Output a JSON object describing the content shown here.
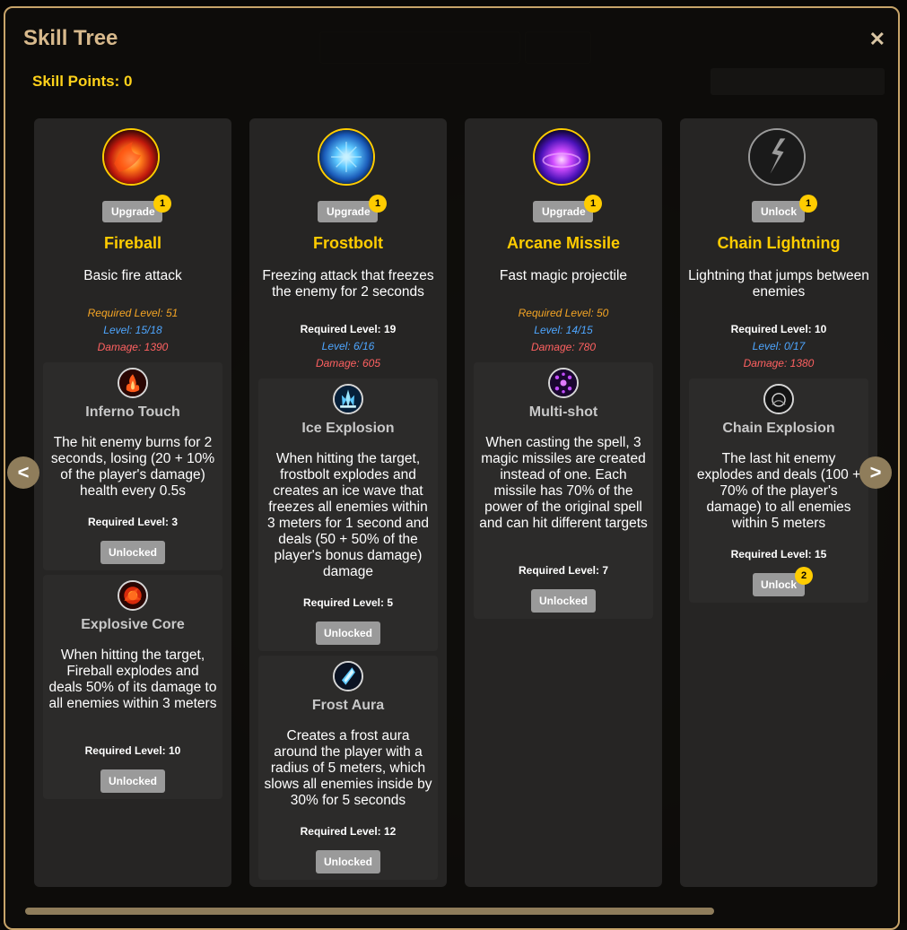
{
  "modal": {
    "title": "Skill Tree",
    "close_glyph": "✕"
  },
  "skill_points": {
    "label": "Skill Points:",
    "value": "0"
  },
  "nav": {
    "prev": "<",
    "next": ">"
  },
  "colors": {
    "accent_gold": "#ffcc00",
    "frame": "#c7a46a",
    "level_blue": "#4ea6ff",
    "damage_red": "#ff6161",
    "required_orange": "#f5a524",
    "button_grey": "#9a9a9a"
  },
  "skills": [
    {
      "icon": "fireball-icon",
      "action": "Upgrade",
      "badge": "1",
      "name": "Fireball",
      "description": "Basic fire attack",
      "required_level": "Required Level: 51",
      "level": "Level: 15/18",
      "damage": "Damage: 1390",
      "subs": [
        {
          "icon": "inferno-icon",
          "name": "Inferno Touch",
          "description": "The hit enemy burns for 2 seconds, losing (20 + 10% of the player's damage) health every 0.5s",
          "required_level": "Required Level: 3",
          "button": "Unlocked"
        },
        {
          "icon": "explosive-core-icon",
          "name": "Explosive Core",
          "description": "When hitting the target, Fireball explodes and deals 50% of its damage to all enemies within 3 meters",
          "required_level": "Required Level: 10",
          "button": "Unlocked"
        }
      ]
    },
    {
      "icon": "frostbolt-icon",
      "action": "Upgrade",
      "badge": "1",
      "name": "Frostbolt",
      "description": "Freezing attack that freezes the enemy for 2 seconds",
      "required_level": "Required Level: 19",
      "level": "Level: 6/16",
      "damage": "Damage: 605",
      "subs": [
        {
          "icon": "ice-explosion-icon",
          "name": "Ice Explosion",
          "description": "When hitting the target, frostbolt explodes and creates an ice wave that freezes all enemies within 3 meters for 1 second and deals (50 + 50% of the player's bonus damage) damage",
          "required_level": "Required Level: 5",
          "button": "Unlocked"
        },
        {
          "icon": "frost-aura-icon",
          "name": "Frost Aura",
          "description": "Creates a frost aura around the player with a radius of 5 meters, which slows all enemies inside by 30% for 5 seconds",
          "required_level": "Required Level: 12",
          "button": "Unlocked"
        }
      ]
    },
    {
      "icon": "arcane-missile-icon",
      "action": "Upgrade",
      "badge": "1",
      "name": "Arcane Missile",
      "description": "Fast magic projectile",
      "required_level": "Required Level: 50",
      "level": "Level: 14/15",
      "damage": "Damage: 780",
      "subs": [
        {
          "icon": "multi-shot-icon",
          "name": "Multi-shot",
          "description": "When casting the spell, 3 magic missiles are created instead of one. Each missile has 70% of the power of the original spell and can hit different targets",
          "required_level": "Required Level: 7",
          "button": "Unlocked"
        }
      ]
    },
    {
      "icon": "chain-lightning-icon",
      "action": "Unlock",
      "badge": "1",
      "name": "Chain Lightning",
      "description": "Lightning that jumps between enemies",
      "required_level": "Required Level: 10",
      "level": "Level: 0/17",
      "damage": "Damage: 1380",
      "subs": [
        {
          "icon": "chain-explosion-icon",
          "name": "Chain Explosion",
          "description": "The last hit enemy explodes and deals (100 + 70% of the player's damage) to all enemies within 5 meters",
          "required_level": "Required Level: 15",
          "button": "Unlock",
          "badge": "2"
        }
      ]
    }
  ]
}
